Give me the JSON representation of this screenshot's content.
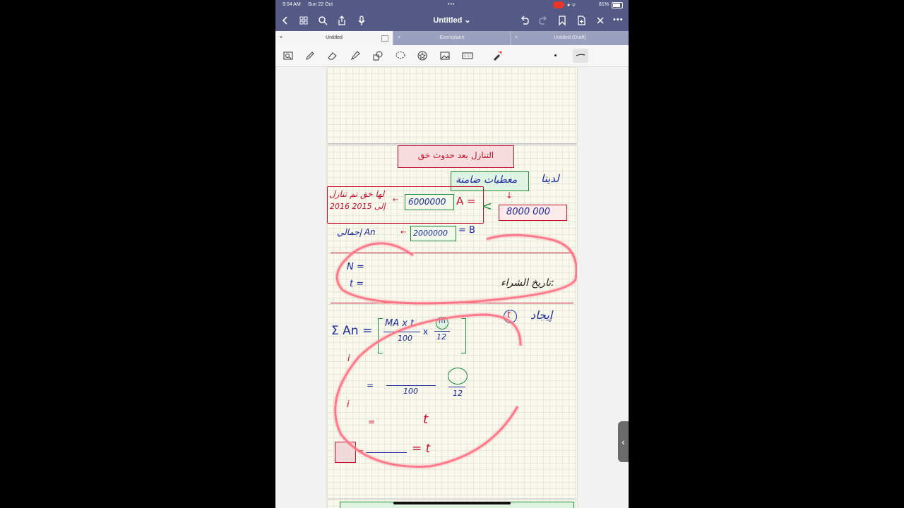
{
  "status": {
    "time": "9:04 AM",
    "date": "Sun 22 Oct",
    "battery": "81%"
  },
  "nav": {
    "title": "Untitled"
  },
  "tabs": [
    {
      "label": "Untitled",
      "active": true
    },
    {
      "label": "Exemplaire",
      "active": false
    },
    {
      "label": "Untitled (Draft)",
      "active": false
    }
  ],
  "notes": {
    "title_ar": "التنازل بعد حدوث خق",
    "ladina": "لدينا",
    "data_box": "معطيات ضامنة",
    "a_label": "A =",
    "a_value": "6000000",
    "a_note": "لها خق تم تنازل",
    "a_years": "2016 إلى 2015",
    "total": "8000 000",
    "b_label": "= B",
    "b_value": "2000000",
    "b_note": "إجمالي An",
    "n_label": "N =",
    "t_label": "t =",
    "purchase_date": "تاريخ الشراء:",
    "find": "إيجاد",
    "find_symbol": "t",
    "sum_label": "Σ An =",
    "formula_num": "MA x t",
    "formula_den": "100",
    "times": "x",
    "m_symbol": "m",
    "twelve": "12",
    "i_mark": "i",
    "eq_sign": "=",
    "t_symbol": "t",
    "eq_t": "= t"
  },
  "colors": {
    "chrome": "#545a85",
    "tabbar": "#9aa0bd",
    "ink_blue": "#1d2a9e",
    "ink_red": "#c8102e",
    "ink_green": "#1e8a3a",
    "paper": "#f8f8ec"
  }
}
